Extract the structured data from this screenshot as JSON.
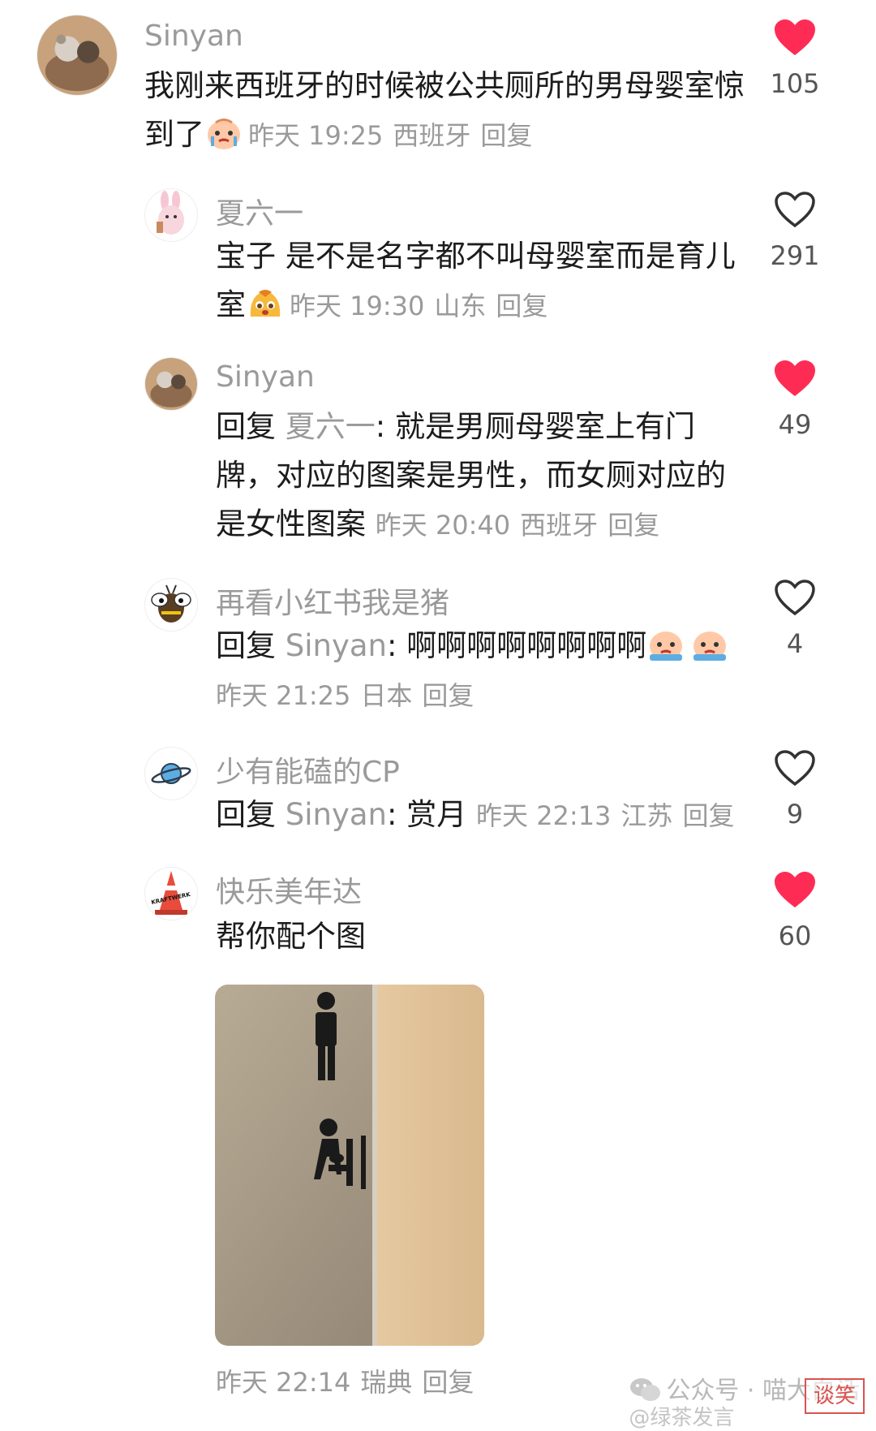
{
  "comments": [
    {
      "username": "Sinyan",
      "text": "我刚来西班牙的时候被公共厕所的男母婴室惊到了",
      "time": "昨天 19:25",
      "location": "西班牙",
      "reply_label": "回复",
      "likes": "105",
      "liked": true,
      "emoji": "crying-baby-emoji"
    },
    {
      "username": "夏六一",
      "text": "宝子  是不是名字都不叫母婴室而是育儿室",
      "time": "昨天 19:30",
      "location": "山东",
      "reply_label": "回复",
      "likes": "291",
      "liked": false,
      "emoji": "pudding-face-emoji"
    },
    {
      "username": "Sinyan",
      "reply_prefix": "回复",
      "reply_to": "夏六一",
      "text": "就是男厕母婴室上有门牌，对应的图案是男性，而女厕对应的是女性图案",
      "time": "昨天 20:40",
      "location": "西班牙",
      "reply_label": "回复",
      "likes": "49",
      "liked": true
    },
    {
      "username": "再看小红书我是猪",
      "reply_prefix": "回复",
      "reply_to": "Sinyan",
      "text": "啊啊啊啊啊啊啊啊",
      "time": "昨天 21:25",
      "location": "日本",
      "reply_label": "回复",
      "likes": "4",
      "liked": false,
      "emoji": "crying-baby-emoji"
    },
    {
      "username": "少有能磕的CP",
      "reply_prefix": "回复",
      "reply_to": "Sinyan",
      "text": "赏月",
      "time": "昨天 22:13",
      "location": "江苏",
      "reply_label": "回复",
      "likes": "9",
      "liked": false
    },
    {
      "username": "快乐美年达",
      "text": "帮你配个图",
      "time": "昨天 22:14",
      "location": "瑞典",
      "reply_label": "回复",
      "likes": "60",
      "liked": true
    }
  ],
  "avatar_texts": {
    "traffic_cone": "KRAFTWERK"
  },
  "watermark": "公众号 · 喵大白话",
  "watermark_sub": "@绿茶发言",
  "stamp": "谈笑",
  "colors": {
    "heart_liked": "#fe2c55",
    "heart_outline": "#333333",
    "meta_gray": "#9a9a9a"
  }
}
